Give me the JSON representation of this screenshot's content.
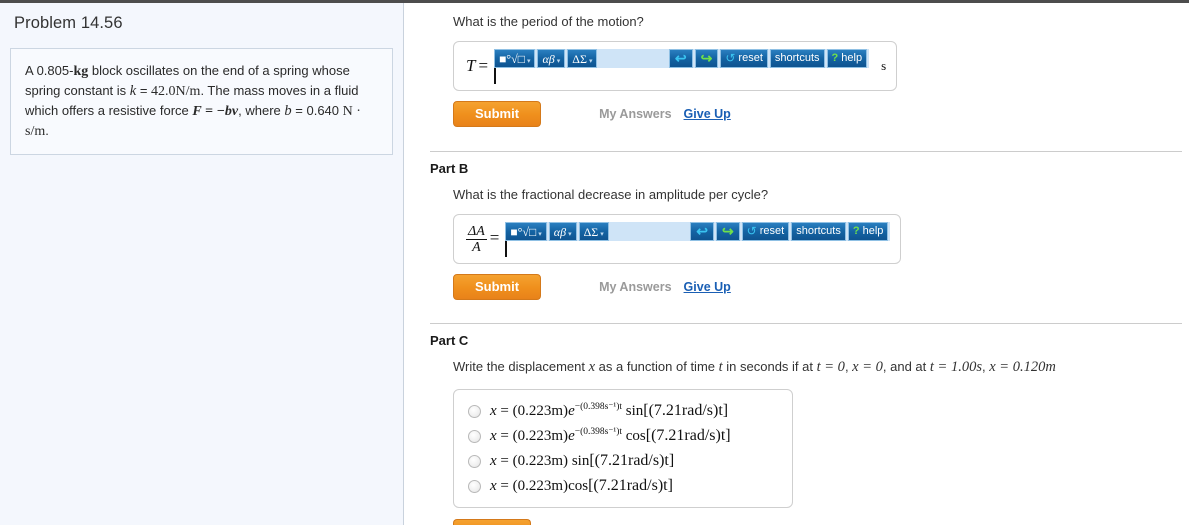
{
  "topbar": {
    "present": true
  },
  "left": {
    "problem_title": "Problem 14.56",
    "statement": {
      "seg1": "A 0.805-",
      "mass_unit": "kg",
      "seg2": " block oscillates on the end of a spring whose spring constant is ",
      "k_sym": "k",
      "k_eq": " = ",
      "k_val": "42.0N/m",
      "seg3": ". The mass moves in a fluid which offers a resistive force ",
      "F_expr": "F = −bv",
      "seg4": ", where ",
      "b_sym": "b",
      "b_eq": " = 0.640",
      "b_unit": "N · s/m",
      "period": "."
    }
  },
  "toolbar": {
    "templates_label": "■°√□",
    "greek_label": "αβ",
    "operators_label": "ΔΣ",
    "caret": "▾",
    "undo_glyph": "↩",
    "redo_glyph": "↪",
    "reset_glyph": "↺",
    "reset_label": "reset",
    "shortcuts_label": "shortcuts",
    "help_glyph": "?",
    "help_label": "help"
  },
  "actions": {
    "submit_label": "Submit",
    "my_answers_label": "My Answers",
    "give_up_label": "Give Up"
  },
  "parts": {
    "a": {
      "question": "What is the period of the motion?",
      "answer_symbol": "T",
      "equals": "=",
      "unit": "s",
      "input_value": ""
    },
    "b": {
      "heading": "Part B",
      "question": "What is the fractional decrease in amplitude per cycle?",
      "frac_numerator": "ΔA",
      "frac_denominator": "A",
      "equals": "=",
      "unit": "",
      "input_value": ""
    },
    "c": {
      "heading": "Part C",
      "question_pre": "Write the displacement ",
      "x_sym": "x",
      "question_mid1": " as a function of time ",
      "t_sym": "t",
      "question_mid2": " in seconds if at ",
      "cond1": "t = 0",
      "question_mid3": ", ",
      "cond2": "x = 0",
      "question_mid4": ", and at ",
      "cond3": "t = 1.00s",
      "question_mid5": ", ",
      "cond4": "x = 0.120m",
      "choices": [
        {
          "id": "choice-1",
          "amplitude": "(0.223m)",
          "damping": "e",
          "damp_exp": "−(0.398s⁻¹)t",
          "trig": "sin",
          "arg": "[(7.21rad/s)t]",
          "selected": false
        },
        {
          "id": "choice-2",
          "amplitude": "(0.223m)",
          "damping": "e",
          "damp_exp": "−(0.398s⁻¹)t",
          "trig": "cos",
          "arg": "[(7.21rad/s)t]",
          "selected": false
        },
        {
          "id": "choice-3",
          "amplitude": "(0.223m)",
          "damping": "",
          "damp_exp": "",
          "trig": "sin",
          "arg": "[(7.21rad/s)t]",
          "selected": false
        },
        {
          "id": "choice-4",
          "amplitude": "(0.223m)",
          "damping": "",
          "damp_exp": "",
          "trig": "cos",
          "arg": "[(7.21rad/s)t]",
          "selected": false
        }
      ]
    }
  },
  "colors": {
    "panel_bg": "#f4f7fd",
    "toolbar_bg": "#cfe4f7",
    "toolbar_btn": "#1463a3",
    "submit_orange": "#ef8f1c",
    "link_blue": "#1a5fb4",
    "muted_gray": "#9a9a9a"
  }
}
